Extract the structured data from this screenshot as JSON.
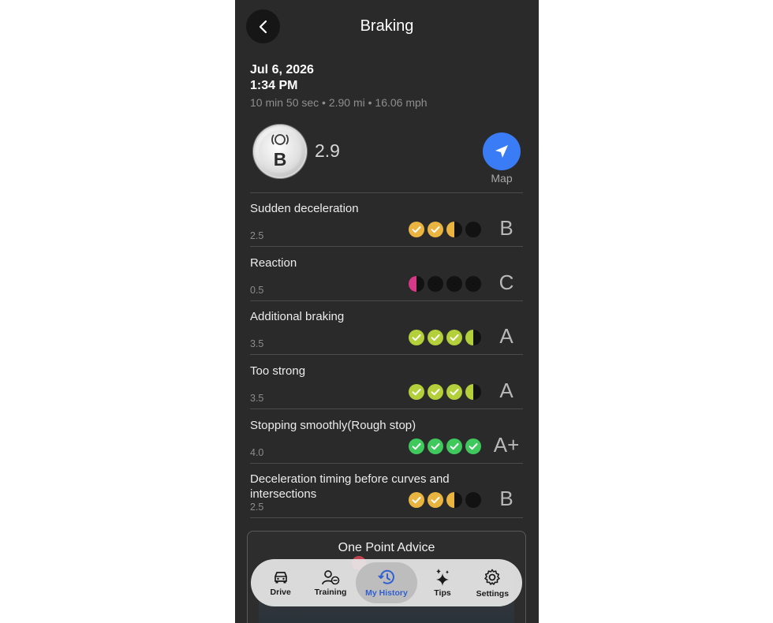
{
  "header": {
    "title": "Braking"
  },
  "trip": {
    "date": "Jul 6, 2026",
    "time": "1:34 PM",
    "meta": "10 min 50 sec • 2.90 mi • 16.06 mph"
  },
  "overall": {
    "grade": "B",
    "score": "2.9"
  },
  "map": {
    "label": "Map"
  },
  "colors": {
    "background": "#2a2a2a",
    "yellow": "#e9b440",
    "lime": "#b3cf3a",
    "green": "#3fc85c",
    "pink": "#d63a86",
    "accent_blue": "#3a7cf5",
    "empty_dot": "#121212"
  },
  "metrics": [
    {
      "label": "Sudden deceleration",
      "score": "2.5",
      "grade": "B",
      "color": "#e9b440",
      "rating": 2.5
    },
    {
      "label": "Reaction",
      "score": "0.5",
      "grade": "C",
      "color": "#d63a86",
      "rating": 0.5
    },
    {
      "label": "Additional braking",
      "score": "3.5",
      "grade": "A",
      "color": "#b3cf3a",
      "rating": 3.5
    },
    {
      "label": "Too strong",
      "score": "3.5",
      "grade": "A",
      "color": "#b3cf3a",
      "rating": 3.5
    },
    {
      "label": "Stopping smoothly(Rough stop)",
      "score": "4.0",
      "grade": "A+",
      "color": "#3fc85c",
      "rating": 4.0
    },
    {
      "label": "Deceleration timing before curves and intersections",
      "score": "2.5",
      "grade": "B",
      "color": "#e9b440",
      "rating": 2.5
    }
  ],
  "advice": {
    "title": "One Point Advice"
  },
  "tabs": [
    {
      "label": "Drive",
      "icon": "car-icon",
      "active": false
    },
    {
      "label": "Training",
      "icon": "training-icon",
      "active": false
    },
    {
      "label": "My History",
      "icon": "history-icon",
      "active": true
    },
    {
      "label": "Tips",
      "icon": "sparkle-icon",
      "active": false
    },
    {
      "label": "Settings",
      "icon": "gear-icon",
      "active": false
    }
  ]
}
